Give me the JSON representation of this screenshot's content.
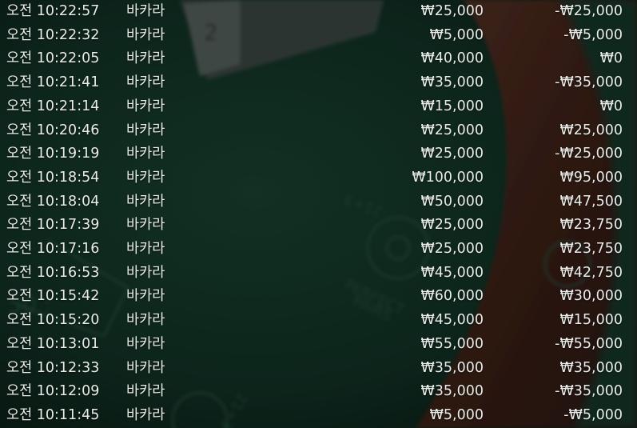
{
  "history": {
    "rows": [
      {
        "time": "오전 10:22:57",
        "game": "바카라",
        "bet": "₩25,000",
        "payout": "-₩25,000"
      },
      {
        "time": "오전 10:22:32",
        "game": "바카라",
        "bet": "₩5,000",
        "payout": "-₩5,000"
      },
      {
        "time": "오전 10:22:05",
        "game": "바카라",
        "bet": "₩40,000",
        "payout": "₩0"
      },
      {
        "time": "오전 10:21:41",
        "game": "바카라",
        "bet": "₩35,000",
        "payout": "-₩35,000"
      },
      {
        "time": "오전 10:21:14",
        "game": "바카라",
        "bet": "₩15,000",
        "payout": "₩0"
      },
      {
        "time": "오전 10:20:46",
        "game": "바카라",
        "bet": "₩25,000",
        "payout": "₩25,000"
      },
      {
        "time": "오전 10:19:19",
        "game": "바카라",
        "bet": "₩25,000",
        "payout": "-₩25,000"
      },
      {
        "time": "오전 10:18:54",
        "game": "바카라",
        "bet": "₩100,000",
        "payout": "₩95,000"
      },
      {
        "time": "오전 10:18:04",
        "game": "바카라",
        "bet": "₩50,000",
        "payout": "₩47,500"
      },
      {
        "time": "오전 10:17:39",
        "game": "바카라",
        "bet": "₩25,000",
        "payout": "₩23,750"
      },
      {
        "time": "오전 10:17:16",
        "game": "바카라",
        "bet": "₩25,000",
        "payout": "₩23,750"
      },
      {
        "time": "오전 10:16:53",
        "game": "바카라",
        "bet": "₩45,000",
        "payout": "₩42,750"
      },
      {
        "time": "오전 10:15:42",
        "game": "바카라",
        "bet": "₩60,000",
        "payout": "₩30,000"
      },
      {
        "time": "오전 10:15:20",
        "game": "바카라",
        "bet": "₩45,000",
        "payout": "₩15,000"
      },
      {
        "time": "오전 10:13:01",
        "game": "바카라",
        "bet": "₩55,000",
        "payout": "-₩55,000"
      },
      {
        "time": "오전 10:12:33",
        "game": "바카라",
        "bet": "₩35,000",
        "payout": "₩35,000"
      },
      {
        "time": "오전 10:12:09",
        "game": "바카라",
        "bet": "₩35,000",
        "payout": "-₩35,000"
      },
      {
        "time": "오전 10:11:45",
        "game": "바카라",
        "bet": "₩5,000",
        "payout": "-₩5,000"
      }
    ]
  },
  "background": {
    "felt_color": "#163a2b",
    "felt_dark_color": "#0c2119",
    "rail_color": "#4a2a1f",
    "text_color": "#e9ece9"
  }
}
